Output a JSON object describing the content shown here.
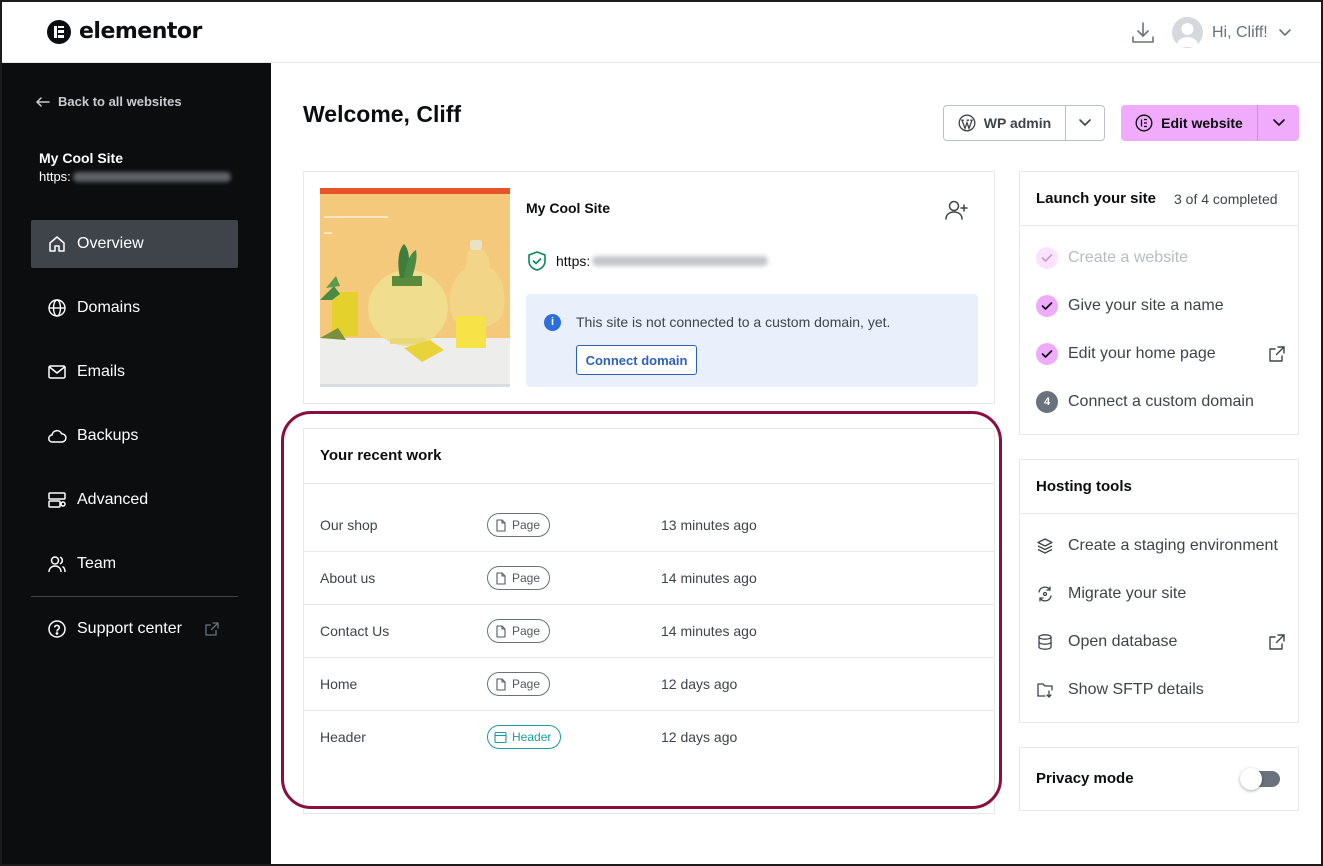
{
  "brand": {
    "name": "elementor"
  },
  "topbar": {
    "greeting": "Hi, Cliff!"
  },
  "sidebar": {
    "back_label": "Back to all websites",
    "site_name": "My Cool Site",
    "site_url_prefix": "https:",
    "items": [
      {
        "label": "Overview",
        "icon": "home-icon",
        "active": true
      },
      {
        "label": "Domains",
        "icon": "globe-icon",
        "active": false
      },
      {
        "label": "Emails",
        "icon": "mail-icon",
        "active": false
      },
      {
        "label": "Backups",
        "icon": "cloud-icon",
        "active": false
      },
      {
        "label": "Advanced",
        "icon": "settings-icon",
        "active": false
      },
      {
        "label": "Team",
        "icon": "users-icon",
        "active": false
      }
    ],
    "support_label": "Support center"
  },
  "main": {
    "welcome": "Welcome, Cliff",
    "wp_admin_label": "WP admin",
    "edit_website_label": "Edit website",
    "site_card": {
      "name": "My Cool Site",
      "url_prefix": "https:",
      "notice": "This site is not connected to a custom domain, yet.",
      "connect_label": "Connect domain"
    },
    "recent_work": {
      "title": "Your recent work",
      "rows": [
        {
          "name": "Our shop",
          "type": "Page",
          "time": "13 minutes ago"
        },
        {
          "name": "About us",
          "type": "Page",
          "time": "14 minutes ago"
        },
        {
          "name": "Contact Us",
          "type": "Page",
          "time": "14 minutes ago"
        },
        {
          "name": "Home",
          "type": "Page",
          "time": "12 days ago"
        },
        {
          "name": "Header",
          "type": "Header",
          "time": "12 days ago"
        }
      ]
    }
  },
  "launch": {
    "title": "Launch your site",
    "progress": "3 of 4 completed",
    "steps": [
      {
        "label": "Create a website",
        "status": "done"
      },
      {
        "label": "Give your site a name",
        "status": "done"
      },
      {
        "label": "Edit your home page",
        "status": "done"
      },
      {
        "label": "Connect a custom domain",
        "status": "pending",
        "number": "4"
      }
    ]
  },
  "hosting": {
    "title": "Hosting tools",
    "tools": [
      {
        "label": "Create a staging environment",
        "icon": "layers-icon"
      },
      {
        "label": "Migrate your site",
        "icon": "migrate-icon"
      },
      {
        "label": "Open database",
        "icon": "database-icon"
      },
      {
        "label": "Show SFTP details",
        "icon": "folder-icon"
      }
    ]
  },
  "privacy": {
    "title": "Privacy mode",
    "enabled": false
  },
  "colors": {
    "accent": "#f0abfc",
    "sidebar_bg": "#0c0d0e",
    "highlight": "#8a0f3e",
    "link": "#2b5fc2"
  }
}
